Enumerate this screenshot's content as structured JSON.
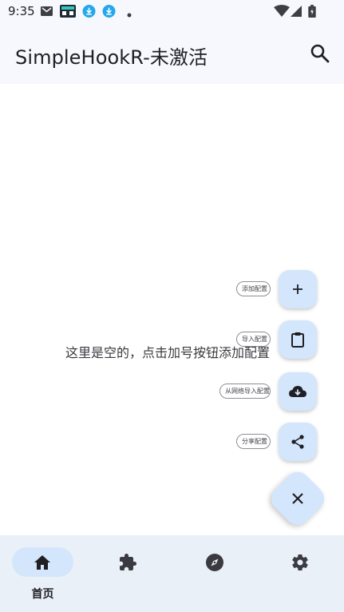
{
  "status_bar": {
    "time": "9:35",
    "icons": [
      "gmail-icon",
      "app-notification-icon",
      "download-icon",
      "download-icon",
      "dot-icon",
      "wifi-icon",
      "signal-icon",
      "battery-icon"
    ]
  },
  "app_bar": {
    "title": "SimpleHookR-未激活",
    "search_icon": "search-icon"
  },
  "main": {
    "empty_message": "这里是空的，点击加号按钮添加配置"
  },
  "fab_menu": {
    "actions": [
      {
        "label": "添加配置",
        "icon": "plus-icon"
      },
      {
        "label": "导入配置",
        "icon": "clipboard-icon"
      },
      {
        "label": "从网络导入配置",
        "icon": "cloud-download-icon"
      },
      {
        "label": "分享配置",
        "icon": "share-icon"
      }
    ],
    "close_icon": "close-icon"
  },
  "bottom_nav": {
    "items": [
      {
        "label": "首页",
        "icon": "home-icon",
        "selected": true
      },
      {
        "label": "",
        "icon": "extension-icon",
        "selected": false
      },
      {
        "label": "",
        "icon": "compass-icon",
        "selected": false
      },
      {
        "label": "",
        "icon": "settings-icon",
        "selected": false
      }
    ]
  },
  "colors": {
    "appbar_bg": "#f6f8fd",
    "fab_bg": "#d3e6fc",
    "nav_bg": "#eaf0f8",
    "text": "#1f1f24"
  }
}
